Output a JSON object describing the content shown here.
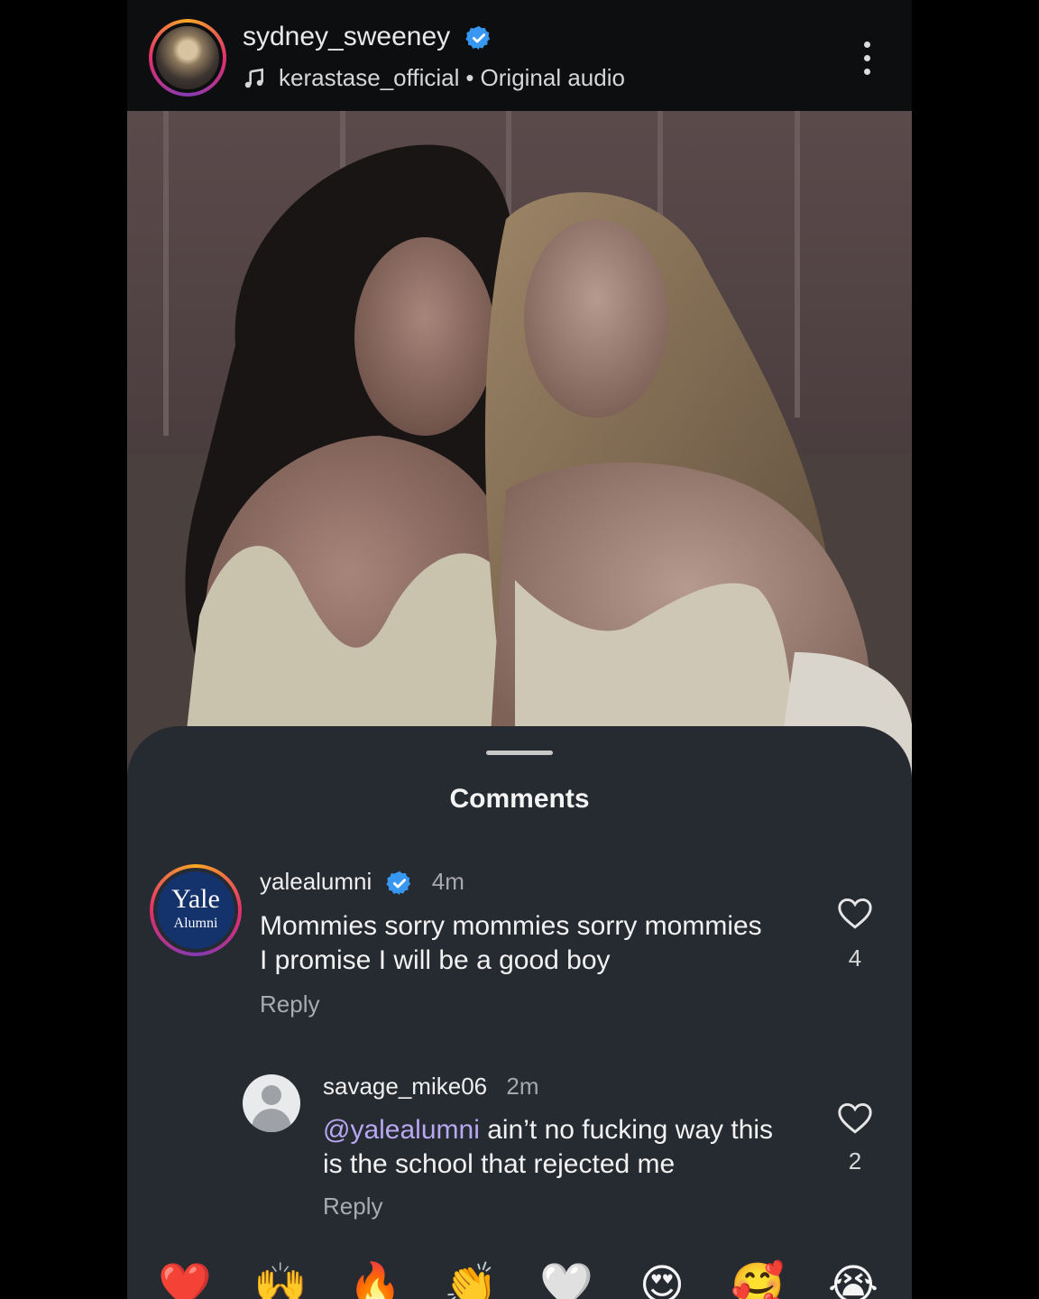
{
  "header": {
    "username": "sydney_sweeney",
    "audio_account": "kerastase_official",
    "audio_separator": "•",
    "audio_label": "Original audio"
  },
  "comments_sheet": {
    "title": "Comments",
    "comments": [
      {
        "username": "yalealumni",
        "verified": true,
        "time": "4m",
        "text_line1": "Mommies sorry mommies sorry mommies",
        "text_line2": "I promise I will be a good boy",
        "reply_label": "Reply",
        "likes": "4",
        "avatar_text_1": "Yale",
        "avatar_text_2": "Alumni"
      },
      {
        "username": "savage_mike06",
        "verified": false,
        "time": "2m",
        "mention": "@yalealumni",
        "text_line1": " ain’t no fucking way this",
        "text_line2": "is the school that rejected me",
        "reply_label": "Reply",
        "likes": "2"
      }
    ]
  },
  "emoji_bar": {
    "items": [
      "red-heart",
      "raising-hands",
      "fire",
      "clapping-hands",
      "white-heart",
      "heart-eyes",
      "smiling-face-with-hearts",
      "loudly-crying-face"
    ],
    "glyphs": [
      "❤️",
      "🙌",
      "🔥",
      "👏",
      "🤍",
      "😍",
      "🥰",
      "😭"
    ]
  },
  "colors": {
    "background": "#000000",
    "sheet": "#262a31",
    "verified_blue": "#3897f0",
    "mention": "#b8a8f2",
    "yale_blue": "#14326b"
  }
}
